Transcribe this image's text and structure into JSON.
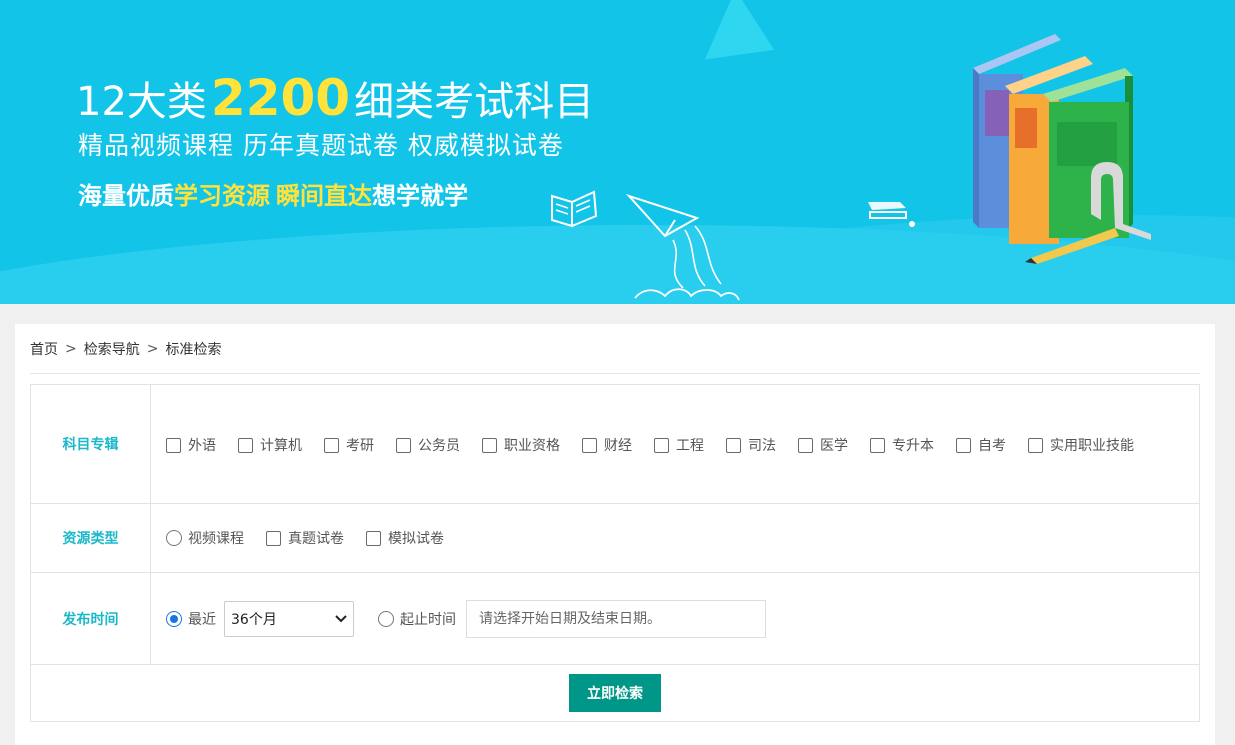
{
  "banner": {
    "line1_a": "12大类",
    "line1_num": "2200",
    "line1_b": "细类考试科目",
    "line2": "精品视频课程 历年真题试卷 权威模拟试卷",
    "line3_a": "海量优质",
    "line3_b": "学习资源",
    "line3_c": "瞬间直达",
    "line3_d": "想学就学"
  },
  "breadcrumb": {
    "home": "首页",
    "sep": ">",
    "nav": "检索导航",
    "current": "标准检索"
  },
  "subject": {
    "label": "科目专辑",
    "options": [
      "外语",
      "计算机",
      "考研",
      "公务员",
      "职业资格",
      "财经",
      "工程",
      "司法",
      "医学",
      "专升本",
      "自考",
      "实用职业技能"
    ]
  },
  "resource_type": {
    "label": "资源类型",
    "options": [
      "视频课程",
      "真题试卷",
      "模拟试卷"
    ]
  },
  "publish_time": {
    "label": "发布时间",
    "recent_label": "最近",
    "recent_value": "36个月",
    "range_label": "起止时间",
    "range_placeholder": "请选择开始日期及结束日期。"
  },
  "search_button": "立即检索",
  "colors": {
    "banner_bg": "#12c4e8",
    "accent_label": "#1bb8c9",
    "highlight_yellow": "#ffe23a",
    "button_bg": "#009688",
    "radio_selected": "#1a73e8"
  },
  "icons": [
    "books-illustration",
    "paper-plane-icon",
    "open-book-icon",
    "stapler-icon",
    "chevron-down-icon"
  ]
}
